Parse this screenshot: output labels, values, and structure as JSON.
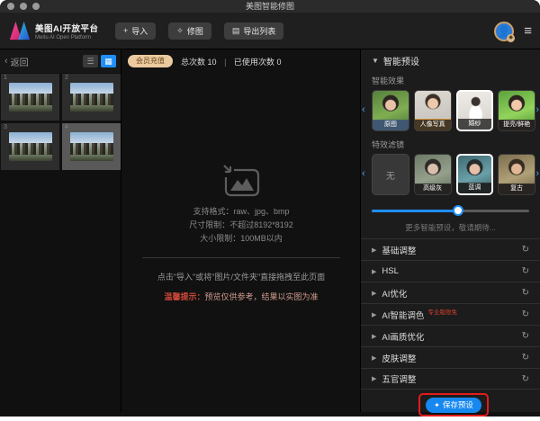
{
  "window": {
    "title": "美图智能修图"
  },
  "toolbar": {
    "brand": "美图AI开放平台",
    "brand_sub": "Meitu AI Open Platform",
    "import_icon": "+",
    "import": "导入",
    "retouch": "修图",
    "export": "导出列表"
  },
  "sidebar": {
    "back": "返回",
    "thumbnails": [
      {
        "index": "1"
      },
      {
        "index": "2"
      },
      {
        "index": "3"
      },
      {
        "index": "4"
      }
    ]
  },
  "usage": {
    "recharge": "会员充值",
    "total_label": "总次数",
    "total_value": "10",
    "divider": "|",
    "used_label": "已使用次数",
    "used_value": "0"
  },
  "dropzone": {
    "formats": "支持格式：raw、jpg、bmp",
    "dimensions": "尺寸限制：不超过8192*8192",
    "filesize": "大小限制：100MB以内",
    "hint": "点击\"导入\"或将\"图片/文件夹\"直接拖拽至此页面",
    "tip_label": "温馨提示：",
    "tip_text": "预览仅供参考，结果以实图为准"
  },
  "panel": {
    "title": "智能预设",
    "effects_title": "智能效果",
    "effects": [
      {
        "label": "原图"
      },
      {
        "label": "人像写真"
      },
      {
        "label": "婚纱",
        "selected": true
      },
      {
        "label": "提亮/鲜艳"
      }
    ],
    "filters_title": "特效滤镜",
    "filters": [
      {
        "label": "无"
      },
      {
        "label": "高级灰"
      },
      {
        "label": "蓝调",
        "selected": true
      },
      {
        "label": "复古"
      }
    ],
    "slider_percent": 55,
    "more": "更多智能预设，敬请期待...",
    "sections": [
      {
        "label": "基础调整"
      },
      {
        "label": "HSL"
      },
      {
        "label": "AI优化"
      },
      {
        "label": "AI智能调色",
        "badge": "专业版限免"
      },
      {
        "label": "AI画质优化"
      },
      {
        "label": "皮肤调整"
      },
      {
        "label": "五官调整"
      }
    ],
    "save": "保存预设"
  },
  "colors": {
    "accent_blue": "#1f8ef5",
    "annotation_red": "#e31b1b",
    "member_gold": "#ecca9f",
    "tip_red": "#d2493a"
  }
}
